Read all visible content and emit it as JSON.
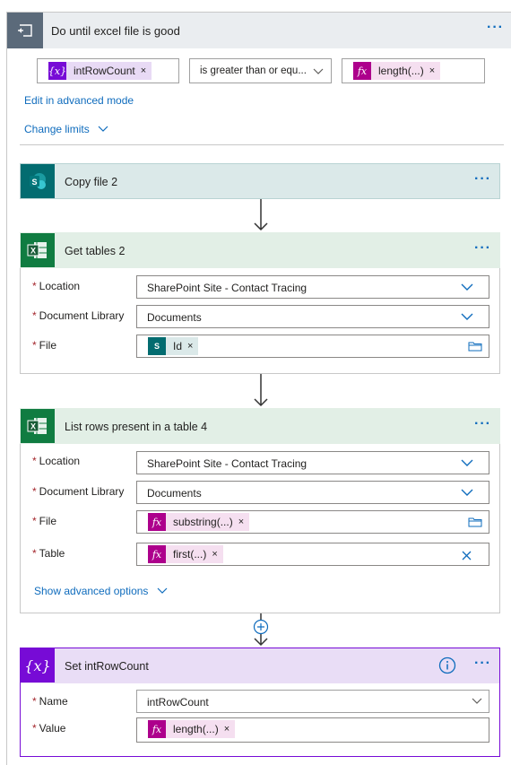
{
  "loop": {
    "title": "Do until excel file is good",
    "condition": {
      "left_token": "intRowCount",
      "operator": "is greater than or equ...",
      "right_token": "length(...)"
    },
    "edit_advanced": "Edit in advanced mode",
    "change_limits": "Change limits"
  },
  "copy_file": {
    "title": "Copy file 2"
  },
  "get_tables": {
    "title": "Get tables 2",
    "fields": {
      "location_label": "Location",
      "location_value": "SharePoint Site - Contact Tracing",
      "library_label": "Document Library",
      "library_value": "Documents",
      "file_label": "File",
      "file_token": "Id"
    }
  },
  "list_rows": {
    "title": "List rows present in a table 4",
    "fields": {
      "location_label": "Location",
      "location_value": "SharePoint Site - Contact Tracing",
      "library_label": "Document Library",
      "library_value": "Documents",
      "file_label": "File",
      "file_token": "substring(...)",
      "table_label": "Table",
      "table_token": "first(...)"
    },
    "advanced": "Show advanced options"
  },
  "set_var": {
    "title": "Set intRowCount",
    "fields": {
      "name_label": "Name",
      "name_value": "intRowCount",
      "value_label": "Value",
      "value_token": "length(...)"
    }
  },
  "symbols": {
    "required": "*",
    "remove": "×",
    "more": "···",
    "var": "{x}",
    "fx": "fx"
  },
  "colors": {
    "accent": "#0f6cbd",
    "variable": "#770bd6",
    "expression": "#ad008c",
    "excel": "#107c41",
    "sharepoint": "#036c70",
    "loop": "#5b6a7a"
  }
}
